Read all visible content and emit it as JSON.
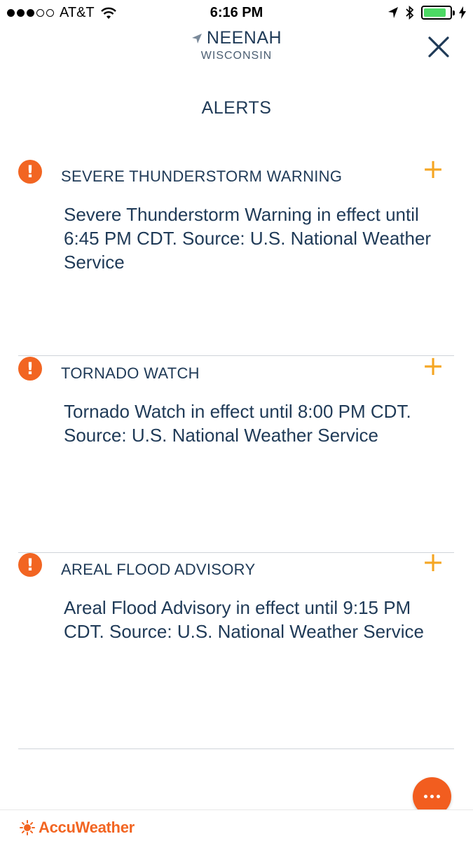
{
  "status_bar": {
    "carrier": "AT&T",
    "time": "6:16 PM",
    "signal_dots": [
      true,
      true,
      true,
      false,
      false
    ],
    "battery_level": 0.85
  },
  "header": {
    "city": "NEENAH",
    "state": "WISCONSIN"
  },
  "page_title": "ALERTS",
  "alerts": [
    {
      "title": "SEVERE THUNDERSTORM WARNING",
      "body": "Severe Thunderstorm Warning in effect until 6:45 PM CDT.  Source: U.S. National Weather Service",
      "icon": "exclamation-icon"
    },
    {
      "title": "TORNADO WATCH",
      "body": "Tornado Watch in effect until 8:00 PM CDT.  Source: U.S. National Weather Service",
      "icon": "exclamation-icon"
    },
    {
      "title": "AREAL FLOOD ADVISORY",
      "body": "Areal Flood Advisory in effect until 9:15 PM CDT.  Source: U.S. National Weather Service",
      "icon": "exclamation-icon"
    }
  ],
  "expand_symbol": "+",
  "footer": {
    "brand": "AccuWeather"
  },
  "colors": {
    "alert_icon": "#f26522",
    "expand": "#f5a623",
    "text": "#1f3a57",
    "fab": "#f25d1f",
    "battery": "#4cd964"
  }
}
